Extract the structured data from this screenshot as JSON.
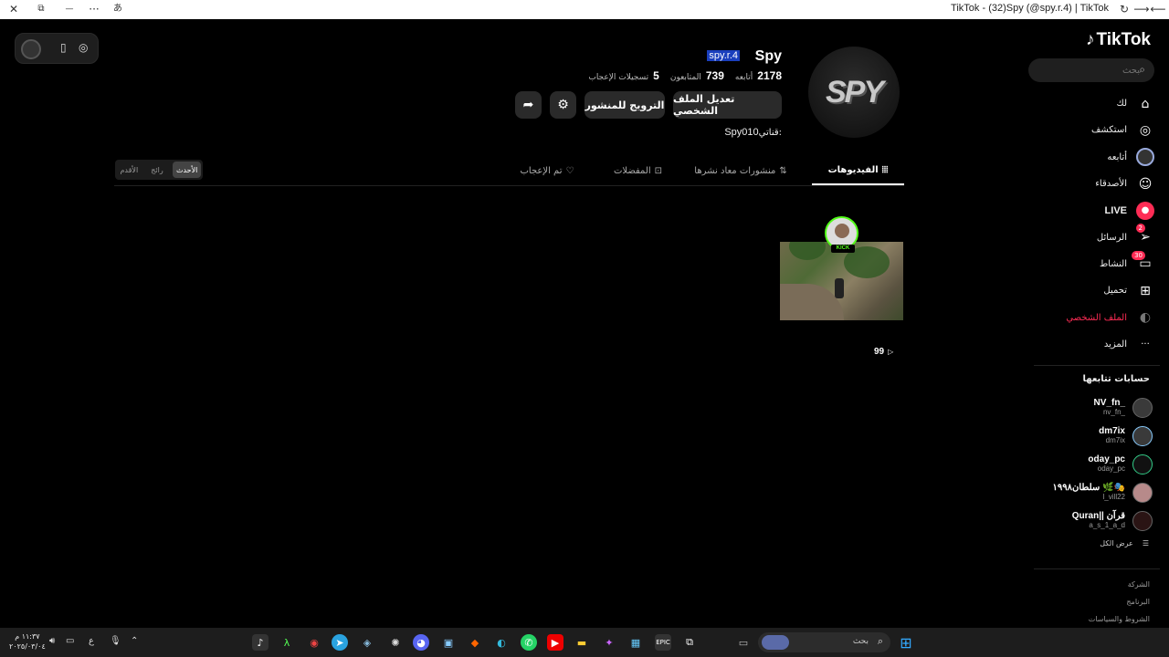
{
  "titlebar": {
    "title": "TikTok - (32)Spy (@spy.r.4) | TikTok",
    "close": "✕",
    "restore": "⧉",
    "minimize": "—",
    "more": "···",
    "translate": "あ",
    "back": "⟵",
    "forward": "⟶",
    "reload": "↻"
  },
  "brand": {
    "logo_text": "TikTok",
    "logo_icon": "♪"
  },
  "search": {
    "placeholder": "بحث",
    "icon": "⌕"
  },
  "nav": [
    {
      "label": "لك",
      "icon": "⌂",
      "icon_name": "home-icon"
    },
    {
      "label": "استكشف",
      "icon": "◎",
      "icon_name": "compass-icon"
    },
    {
      "label": "أتابعه",
      "icon": "",
      "icon_name": "following-avatar-icon"
    },
    {
      "label": "الأصدقاء",
      "icon": "☺",
      "icon_name": "friends-icon"
    },
    {
      "label": "LIVE",
      "icon": "●",
      "icon_name": "live-icon"
    },
    {
      "label": "الرسائل",
      "icon": "➢",
      "icon_name": "messages-icon",
      "badge": "2"
    },
    {
      "label": "النشاط",
      "icon": "▭",
      "icon_name": "activity-icon",
      "badge": "30"
    },
    {
      "label": "تحميل",
      "icon": "⊞",
      "icon_name": "upload-icon"
    },
    {
      "label": "الملف الشخصي",
      "icon": "◐",
      "icon_name": "profile-icon"
    },
    {
      "label": "المزيد",
      "icon": "···",
      "icon_name": "more-icon"
    }
  ],
  "following_section": {
    "title": "حسابات تتابعها",
    "items": [
      {
        "name": "NV_fn_",
        "user": "nv_fn_"
      },
      {
        "name": "dm7ix",
        "user": "dm7ix"
      },
      {
        "name": "oday_pc",
        "user": "oday_pc"
      },
      {
        "name": "سلطان١٩٩٨ 🌿🎭",
        "user": "l_vill22"
      },
      {
        "name": "Quran|| قرآن",
        "user": "a_s_1_a_d"
      }
    ],
    "see_all": "عرض الكل"
  },
  "footer_links": [
    "الشركة",
    "البرنامج",
    "الشروط والسياسات"
  ],
  "profile": {
    "display_name": "Spy",
    "username": "spy.r.4",
    "avatar_text": "SPY",
    "stats": [
      {
        "value": "2178",
        "label": "أتابعه"
      },
      {
        "value": "739",
        "label": "المتابعون"
      },
      {
        "value": "5",
        "label": "تسجيلات الإعجاب"
      }
    ],
    "edit_button": "تعديل الملف الشخصي",
    "promote_button": "الترويج للمنشور",
    "settings_icon": "⚙",
    "share_icon": "➦",
    "bio_label": "قناتي:",
    "bio_value": "Spy010"
  },
  "tabs": [
    {
      "label": "الفيديوهات",
      "icon": "⦙⦙⦙"
    },
    {
      "label": "منشورات معاد نشرها",
      "icon": "⇅"
    },
    {
      "label": "المفضلات",
      "icon": "⊡"
    },
    {
      "label": "تم الإعجاب",
      "icon": "♡"
    }
  ],
  "sort": [
    "الأحدث",
    "رائج",
    "الأقدم"
  ],
  "video": {
    "views": "99",
    "play_icon": "▷",
    "badge": "KICK"
  },
  "taskbar": {
    "search_label": "بحث",
    "time": "١١:٣٧ م",
    "date": "٢٠٢٥/٠٣/٠٤",
    "lang": "ع"
  },
  "colors": {
    "accent": "#fe2c55",
    "selection": "#1a3fbd",
    "kick": "#53fc18"
  }
}
